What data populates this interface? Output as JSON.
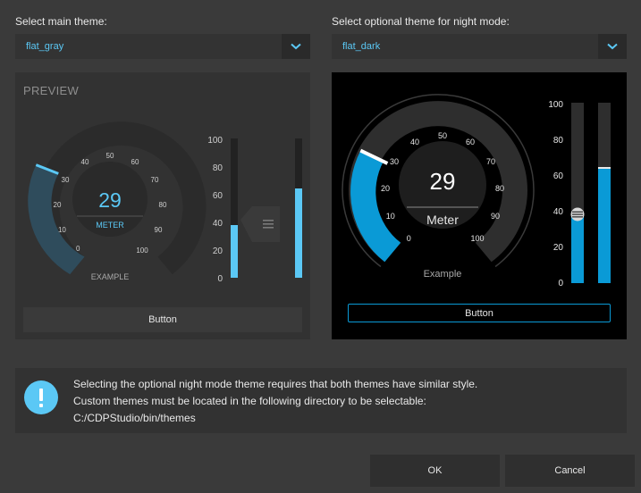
{
  "main_theme": {
    "label": "Select main theme:",
    "value": "flat_gray"
  },
  "night_theme": {
    "label": "Select optional theme for night mode:",
    "value": "flat_dark"
  },
  "preview": {
    "heading": "PREVIEW",
    "gauge": {
      "value": "29",
      "unit": "METER",
      "caption": "EXAMPLE",
      "ticks": [
        "0",
        "10",
        "20",
        "30",
        "40",
        "50",
        "60",
        "70",
        "80",
        "90",
        "100"
      ]
    },
    "scale": [
      "100",
      "80",
      "60",
      "40",
      "20",
      "0"
    ],
    "bar_levels": [
      0.38,
      0.64
    ],
    "button": "Button"
  },
  "night_preview": {
    "gauge": {
      "value": "29",
      "unit": "Meter",
      "caption": "Example",
      "ticks": [
        "0",
        "10",
        "20",
        "30",
        "40",
        "50",
        "60",
        "70",
        "80",
        "90",
        "100"
      ]
    },
    "scale": [
      "100",
      "80",
      "60",
      "40",
      "20",
      "0"
    ],
    "bar_levels": [
      0.38,
      0.64
    ],
    "button": "Button"
  },
  "info": {
    "line1": "Selecting the optional night mode theme requires that both themes have similar style.",
    "line2": "Custom themes must be located in the following directory to be selectable:",
    "line3": "C:/CDPStudio/bin/themes"
  },
  "footer": {
    "ok": "OK",
    "cancel": "Cancel"
  },
  "colors": {
    "accent": "#5bc8f5",
    "night_accent": "#0a9ad6"
  }
}
